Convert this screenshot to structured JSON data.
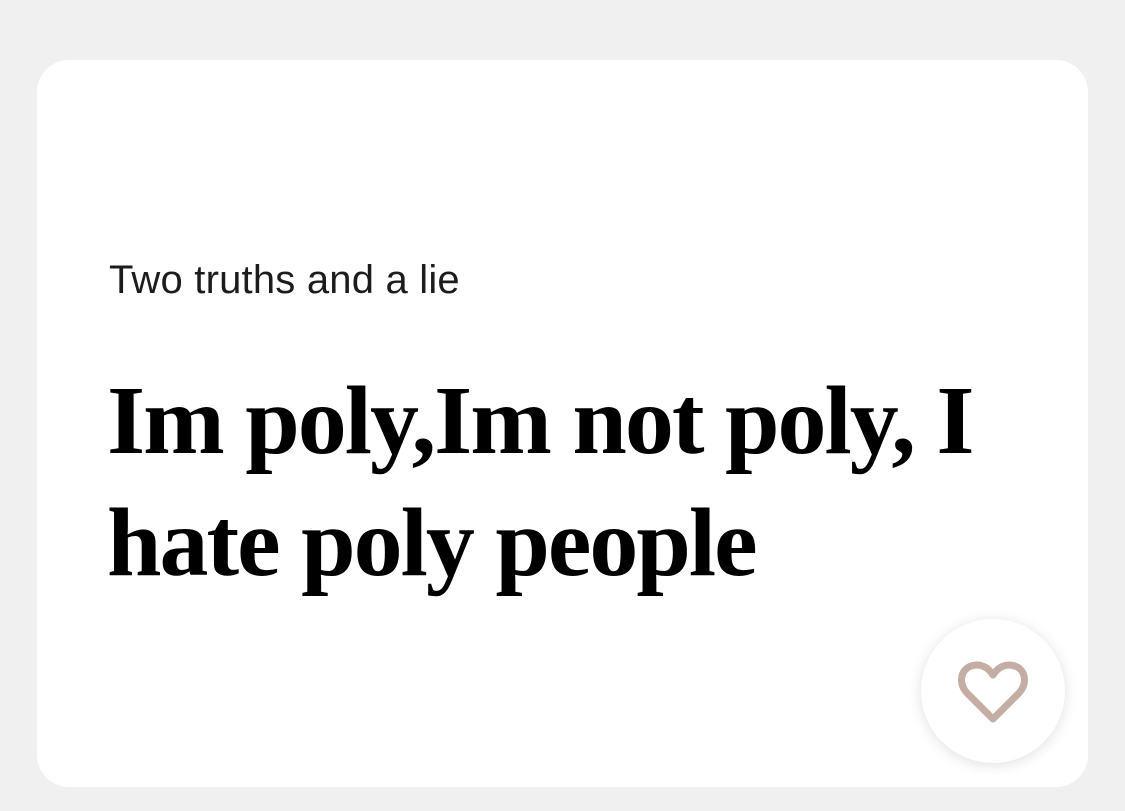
{
  "prompt_card": {
    "label": "Two truths and a lie",
    "answer": "Im poly,Im not poly, I hate poly people"
  },
  "like_button": {
    "icon": "heart-outline-icon",
    "icon_color": "#c4ada2"
  },
  "colors": {
    "background": "#f0f0f0",
    "card": "#ffffff"
  }
}
